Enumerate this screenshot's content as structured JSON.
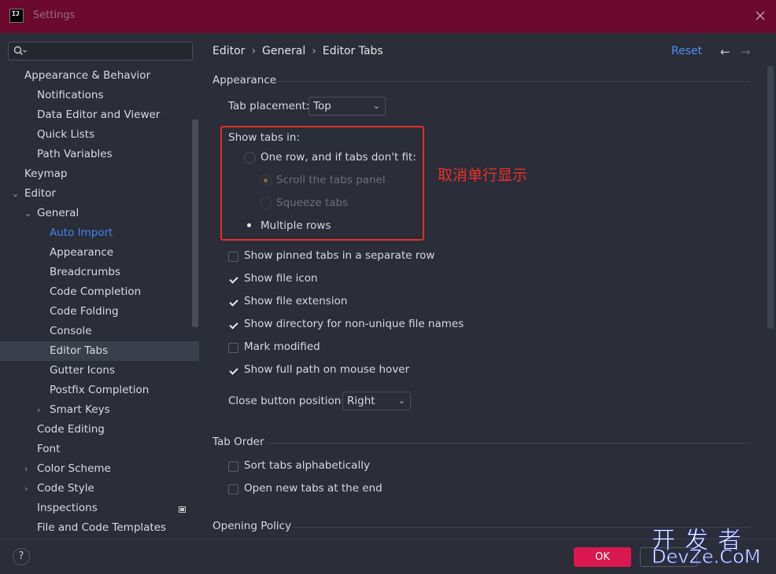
{
  "window": {
    "title": "Settings",
    "logo_text": "IJ"
  },
  "sidebar": {
    "search_placeholder": "",
    "items": [
      {
        "label": "Appearance & Behavior",
        "chevron": ""
      },
      {
        "label": "Notifications",
        "chevron": ""
      },
      {
        "label": "Data Editor and Viewer",
        "chevron": ""
      },
      {
        "label": "Quick Lists",
        "chevron": ""
      },
      {
        "label": "Path Variables",
        "chevron": ""
      },
      {
        "label": "Keymap",
        "chevron": ""
      },
      {
        "label": "Editor",
        "chevron": "⌄"
      },
      {
        "label": "General",
        "chevron": "⌄"
      },
      {
        "label": "Auto Import",
        "chevron": ""
      },
      {
        "label": "Appearance",
        "chevron": ""
      },
      {
        "label": "Breadcrumbs",
        "chevron": ""
      },
      {
        "label": "Code Completion",
        "chevron": ""
      },
      {
        "label": "Code Folding",
        "chevron": ""
      },
      {
        "label": "Console",
        "chevron": ""
      },
      {
        "label": "Editor Tabs",
        "chevron": ""
      },
      {
        "label": "Gutter Icons",
        "chevron": ""
      },
      {
        "label": "Postfix Completion",
        "chevron": ""
      },
      {
        "label": "Smart Keys",
        "chevron": "›"
      },
      {
        "label": "Code Editing",
        "chevron": ""
      },
      {
        "label": "Font",
        "chevron": ""
      },
      {
        "label": "Color Scheme",
        "chevron": "›"
      },
      {
        "label": "Code Style",
        "chevron": "›"
      },
      {
        "label": "Inspections",
        "chevron": ""
      },
      {
        "label": "File and Code Templates",
        "chevron": ""
      }
    ]
  },
  "header": {
    "breadcrumb": [
      "Editor",
      "General",
      "Editor Tabs"
    ],
    "separator": "›",
    "reset_label": "Reset",
    "back_arrow": "←",
    "forward_arrow": "→"
  },
  "appearance": {
    "section_title": "Appearance",
    "tab_placement_label": "Tab placement:",
    "tab_placement_value": "Top",
    "show_tabs_in_label": "Show tabs in:",
    "one_row_label": "One row, and if tabs don't fit:",
    "scroll_label": "Scroll the tabs panel",
    "squeeze_label": "Squeeze tabs",
    "multiple_rows_label": "Multiple rows",
    "annotation": "取消单行显示",
    "checkboxes": [
      {
        "label": "Show pinned tabs in a separate row",
        "checked": false
      },
      {
        "label": "Show file icon",
        "checked": true
      },
      {
        "label": "Show file extension",
        "checked": true
      },
      {
        "label": "Show directory for non-unique file names",
        "checked": true
      },
      {
        "label": "Mark modified",
        "checked": false
      },
      {
        "label": "Show full path on mouse hover",
        "checked": true
      }
    ],
    "close_button_label": "Close button position:",
    "close_button_value": "Right"
  },
  "tab_order": {
    "section_title": "Tab Order",
    "checkboxes": [
      {
        "label": "Sort tabs alphabetically",
        "checked": false
      },
      {
        "label": "Open new tabs at the end",
        "checked": false
      }
    ]
  },
  "opening_policy": {
    "section_title": "Opening Policy"
  },
  "footer": {
    "help_label": "?",
    "ok_label": "OK"
  },
  "watermark": {
    "top": "开发者",
    "bottom": "DevZe.CoM"
  }
}
